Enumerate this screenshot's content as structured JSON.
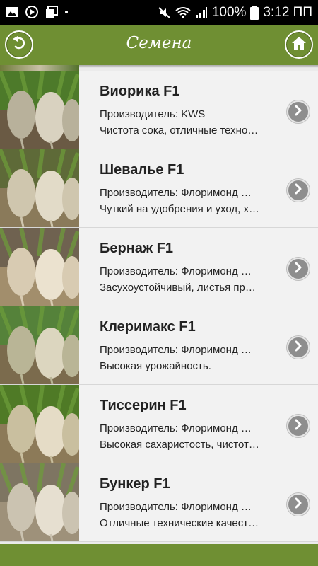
{
  "status_bar": {
    "icons": [
      "image-icon",
      "play-circle-icon",
      "stack-icon",
      "dot-icon"
    ],
    "right_icons": [
      "mute-icon",
      "wifi-icon",
      "signal-icon"
    ],
    "battery": "100%",
    "time": "3:12 ПП"
  },
  "app_bar": {
    "title": "Семена",
    "back_icon": "back-arrow-icon",
    "home_icon": "home-icon",
    "color": "#6f8f33"
  },
  "seeds": [
    {
      "name": "Виорика F1",
      "producer": "Производитель: KWS",
      "description": "Чистота сока, отличные техно…",
      "image": "sugar-beet-photo"
    },
    {
      "name": "Шевалье F1",
      "producer": "Производитель: Флоримонд …",
      "description": "Чуткий на удобрения и уход, х…",
      "image": "sugar-beet-photo"
    },
    {
      "name": "Бернаж F1",
      "producer": "Производитель: Флоримонд …",
      "description": "Засухоустойчивый, листья пр…",
      "image": "sugar-beet-photo"
    },
    {
      "name": "Клеримакс F1",
      "producer": "Производитель: Флоримонд …",
      "description": "Высокая урожайность.",
      "image": "sugar-beet-photo"
    },
    {
      "name": "Тиссерин F1",
      "producer": "Производитель: Флоримонд …",
      "description": "Высокая сахаристость, чистот…",
      "image": "sugar-beet-photo"
    },
    {
      "name": "Бункер F1",
      "producer": "Производитель: Флоримонд …",
      "description": "Отличные технические качест…",
      "image": "sugar-beet-photo"
    }
  ],
  "row_action_icon": "chevron-right-icon"
}
